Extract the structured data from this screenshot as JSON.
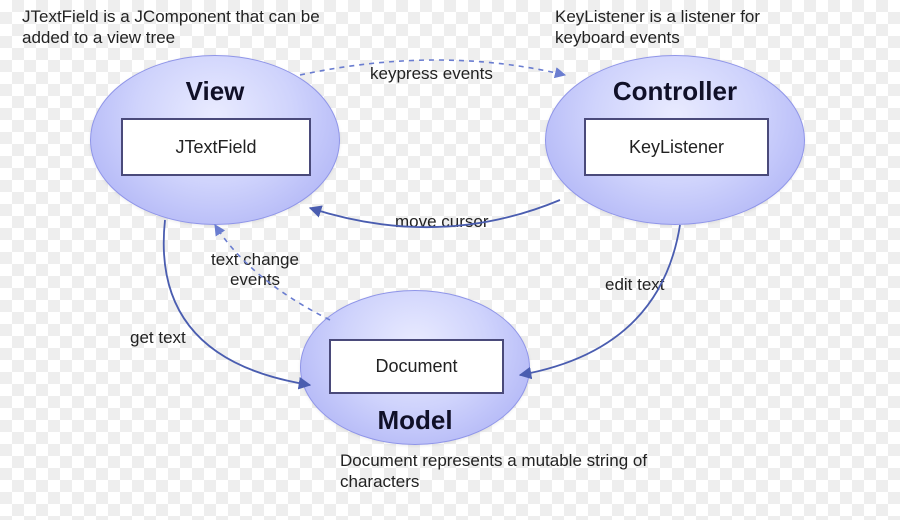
{
  "descriptions": {
    "view": "JTextField is a JComponent that can be added to a view tree",
    "controller": "KeyListener is a listener for keyboard events",
    "model": "Document represents a mutable string of characters"
  },
  "nodes": {
    "view": {
      "title": "View",
      "box": "JTextField"
    },
    "controller": {
      "title": "Controller",
      "box": "KeyListener"
    },
    "model": {
      "title": "Model",
      "box": "Document"
    }
  },
  "edges": {
    "view_to_controller": "keypress events",
    "controller_to_view": "move cursor",
    "controller_to_model": "edit text",
    "model_to_view": "text change events",
    "view_to_model": "get text"
  }
}
